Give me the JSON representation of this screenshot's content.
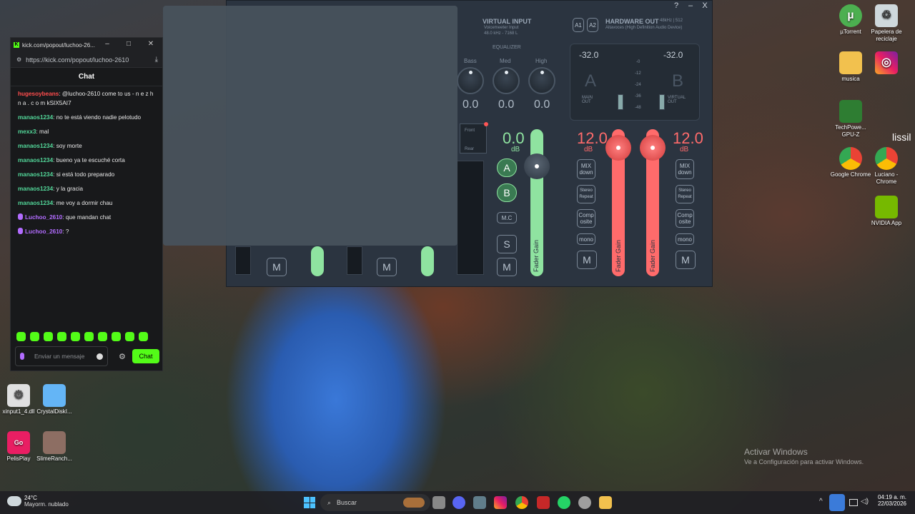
{
  "colors": {
    "kick_green": "#53fc18",
    "fader_green": "#8fe3a0",
    "fader_red": "#ff6b6b",
    "chat_user_green": "#53d89a",
    "chat_user_red": "#ff4d4d",
    "chat_user_purple": "#b26cff"
  },
  "desktop": {
    "icons": [
      {
        "label": "µTorrent",
        "icon": "utorrent-icon"
      },
      {
        "label": "Papelera de reciclaje",
        "icon": "recycle-bin-icon"
      },
      {
        "label": "musica",
        "icon": "folder-icon"
      },
      {
        "label": "TechPowe... GPU-Z",
        "icon": "gpuz-icon"
      },
      {
        "label": "Google Chrome",
        "icon": "chrome-icon"
      },
      {
        "label": "Luciano - Chrome",
        "icon": "chrome-profile-icon"
      },
      {
        "label": "NVIDIA App",
        "icon": "nvidia-icon"
      },
      {
        "label": "xinput1_4.dll",
        "icon": "dll-icon"
      },
      {
        "label": "CrystalDiskI...",
        "icon": "crystaldisk-icon"
      },
      {
        "label": "PelisPlay",
        "icon": "pelisplay-icon"
      },
      {
        "label": "SlimeRanch...",
        "icon": "slimerancher-icon"
      }
    ],
    "partial_text": "lissil",
    "activate_title": "Activar Windows",
    "activate_sub": "Ve a Configuración para activar Windows."
  },
  "voicemeeter": {
    "virtual_input_title": "VIRTUAL INPUT",
    "virtual_input_sub": "Voicemeeter Input",
    "virtual_input_rate": "48.0 kHz - 7168 L",
    "hardware_out_title": "HARDWARE OUT",
    "hardware_out_rate": "48kHz | 512",
    "hardware_out_device": "Altavoces (High Definition Audio Device)",
    "bus_a1": "A1",
    "bus_a2": "A2",
    "equalizer": "EQUALIZER",
    "eq_bass": "Bass",
    "eq_med": "Med",
    "eq_high": "High",
    "eq_bass_val": "0.0",
    "eq_med_val": "0.0",
    "eq_high_val": "0.0",
    "db_unit": "dB",
    "main_out_db": "-32.0",
    "virtual_out_db": "-32.0",
    "main_label": "MAIN OUT",
    "virtual_label": "VIRTUAL OUT",
    "letter_a": "A",
    "letter_b": "B",
    "scale": [
      "-0",
      "-12",
      "-24",
      "-36",
      "-48"
    ],
    "front": "Front",
    "rear": "Rear",
    "fader_db": "0.0",
    "fader_a": "A",
    "fader_b": "B",
    "mc": "M.C",
    "solo": "S",
    "mute": "M",
    "fader_label": "Fader Gain",
    "hw_gain_left": "12.0",
    "hw_gain_right": "12.0",
    "mix_down": "MIX down",
    "stereo_repeat": "Stereo Repeat",
    "composite": "Comp osite",
    "mono": "mono"
  },
  "chat_window": {
    "title": "kick.com/popout/luchoo-26...",
    "url": "https://kick.com/popout/luchoo-2610",
    "header": "Chat",
    "messages": [
      {
        "user": "hugesoybeans",
        "color": "#ff4d4d",
        "text": ": @luchoo-2610 come to us - n e z h n a . c o m kSIX5AI7",
        "badge": false
      },
      {
        "user": "manaos1234",
        "color": "#53d89a",
        "text": ": no te está viendo nadie pelotudo",
        "badge": false
      },
      {
        "user": "mexx3",
        "color": "#53d89a",
        "text": ": mal",
        "badge": false
      },
      {
        "user": "manaos1234",
        "color": "#53d89a",
        "text": ": soy morte",
        "badge": false
      },
      {
        "user": "manaos1234",
        "color": "#53d89a",
        "text": ": bueno ya te escuché corta",
        "badge": false
      },
      {
        "user": "manaos1234",
        "color": "#53d89a",
        "text": ": si está todo preparado",
        "badge": false
      },
      {
        "user": "manaos1234",
        "color": "#53d89a",
        "text": ": y la gracia",
        "badge": false
      },
      {
        "user": "manaos1234",
        "color": "#53d89a",
        "text": ": me voy a dormir chau",
        "badge": false
      },
      {
        "user": "Luchoo_2610",
        "color": "#b26cff",
        "text": ": que mandan chat",
        "badge": true
      },
      {
        "user": "Luchoo_2610",
        "color": "#b26cff",
        "text": ": ?",
        "badge": true
      }
    ],
    "input_placeholder": "Enviar un mensaje",
    "send_label": "Chat"
  },
  "taskbar": {
    "weather_temp": "24°C",
    "weather_desc": "Mayorm. nublado",
    "search_placeholder": "Buscar",
    "time": "04:19 a. m.",
    "date": "22/03/2026",
    "tray_chevron": "^"
  }
}
